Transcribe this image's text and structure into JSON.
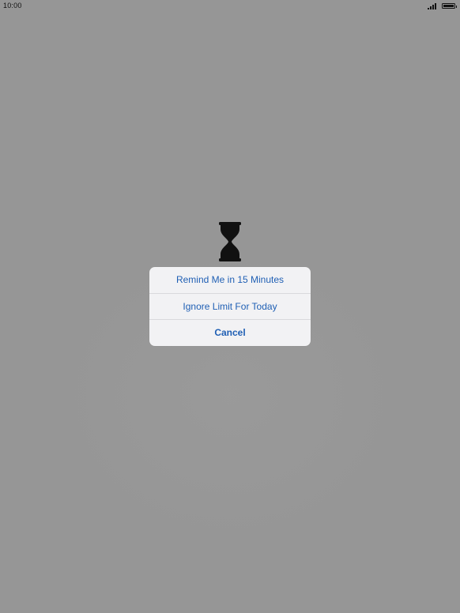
{
  "status_bar": {
    "time": "10:00",
    "signal_icon": "signal-bars-icon",
    "battery_icon": "battery-full-icon"
  },
  "screen": {
    "background_color": "#969696",
    "center_icon": "hourglass-icon"
  },
  "action_sheet": {
    "remind_label": "Remind Me in 15 Minutes",
    "ignore_label": "Ignore Limit For Today",
    "cancel_label": "Cancel",
    "accent_color": "#1f5fb4"
  }
}
